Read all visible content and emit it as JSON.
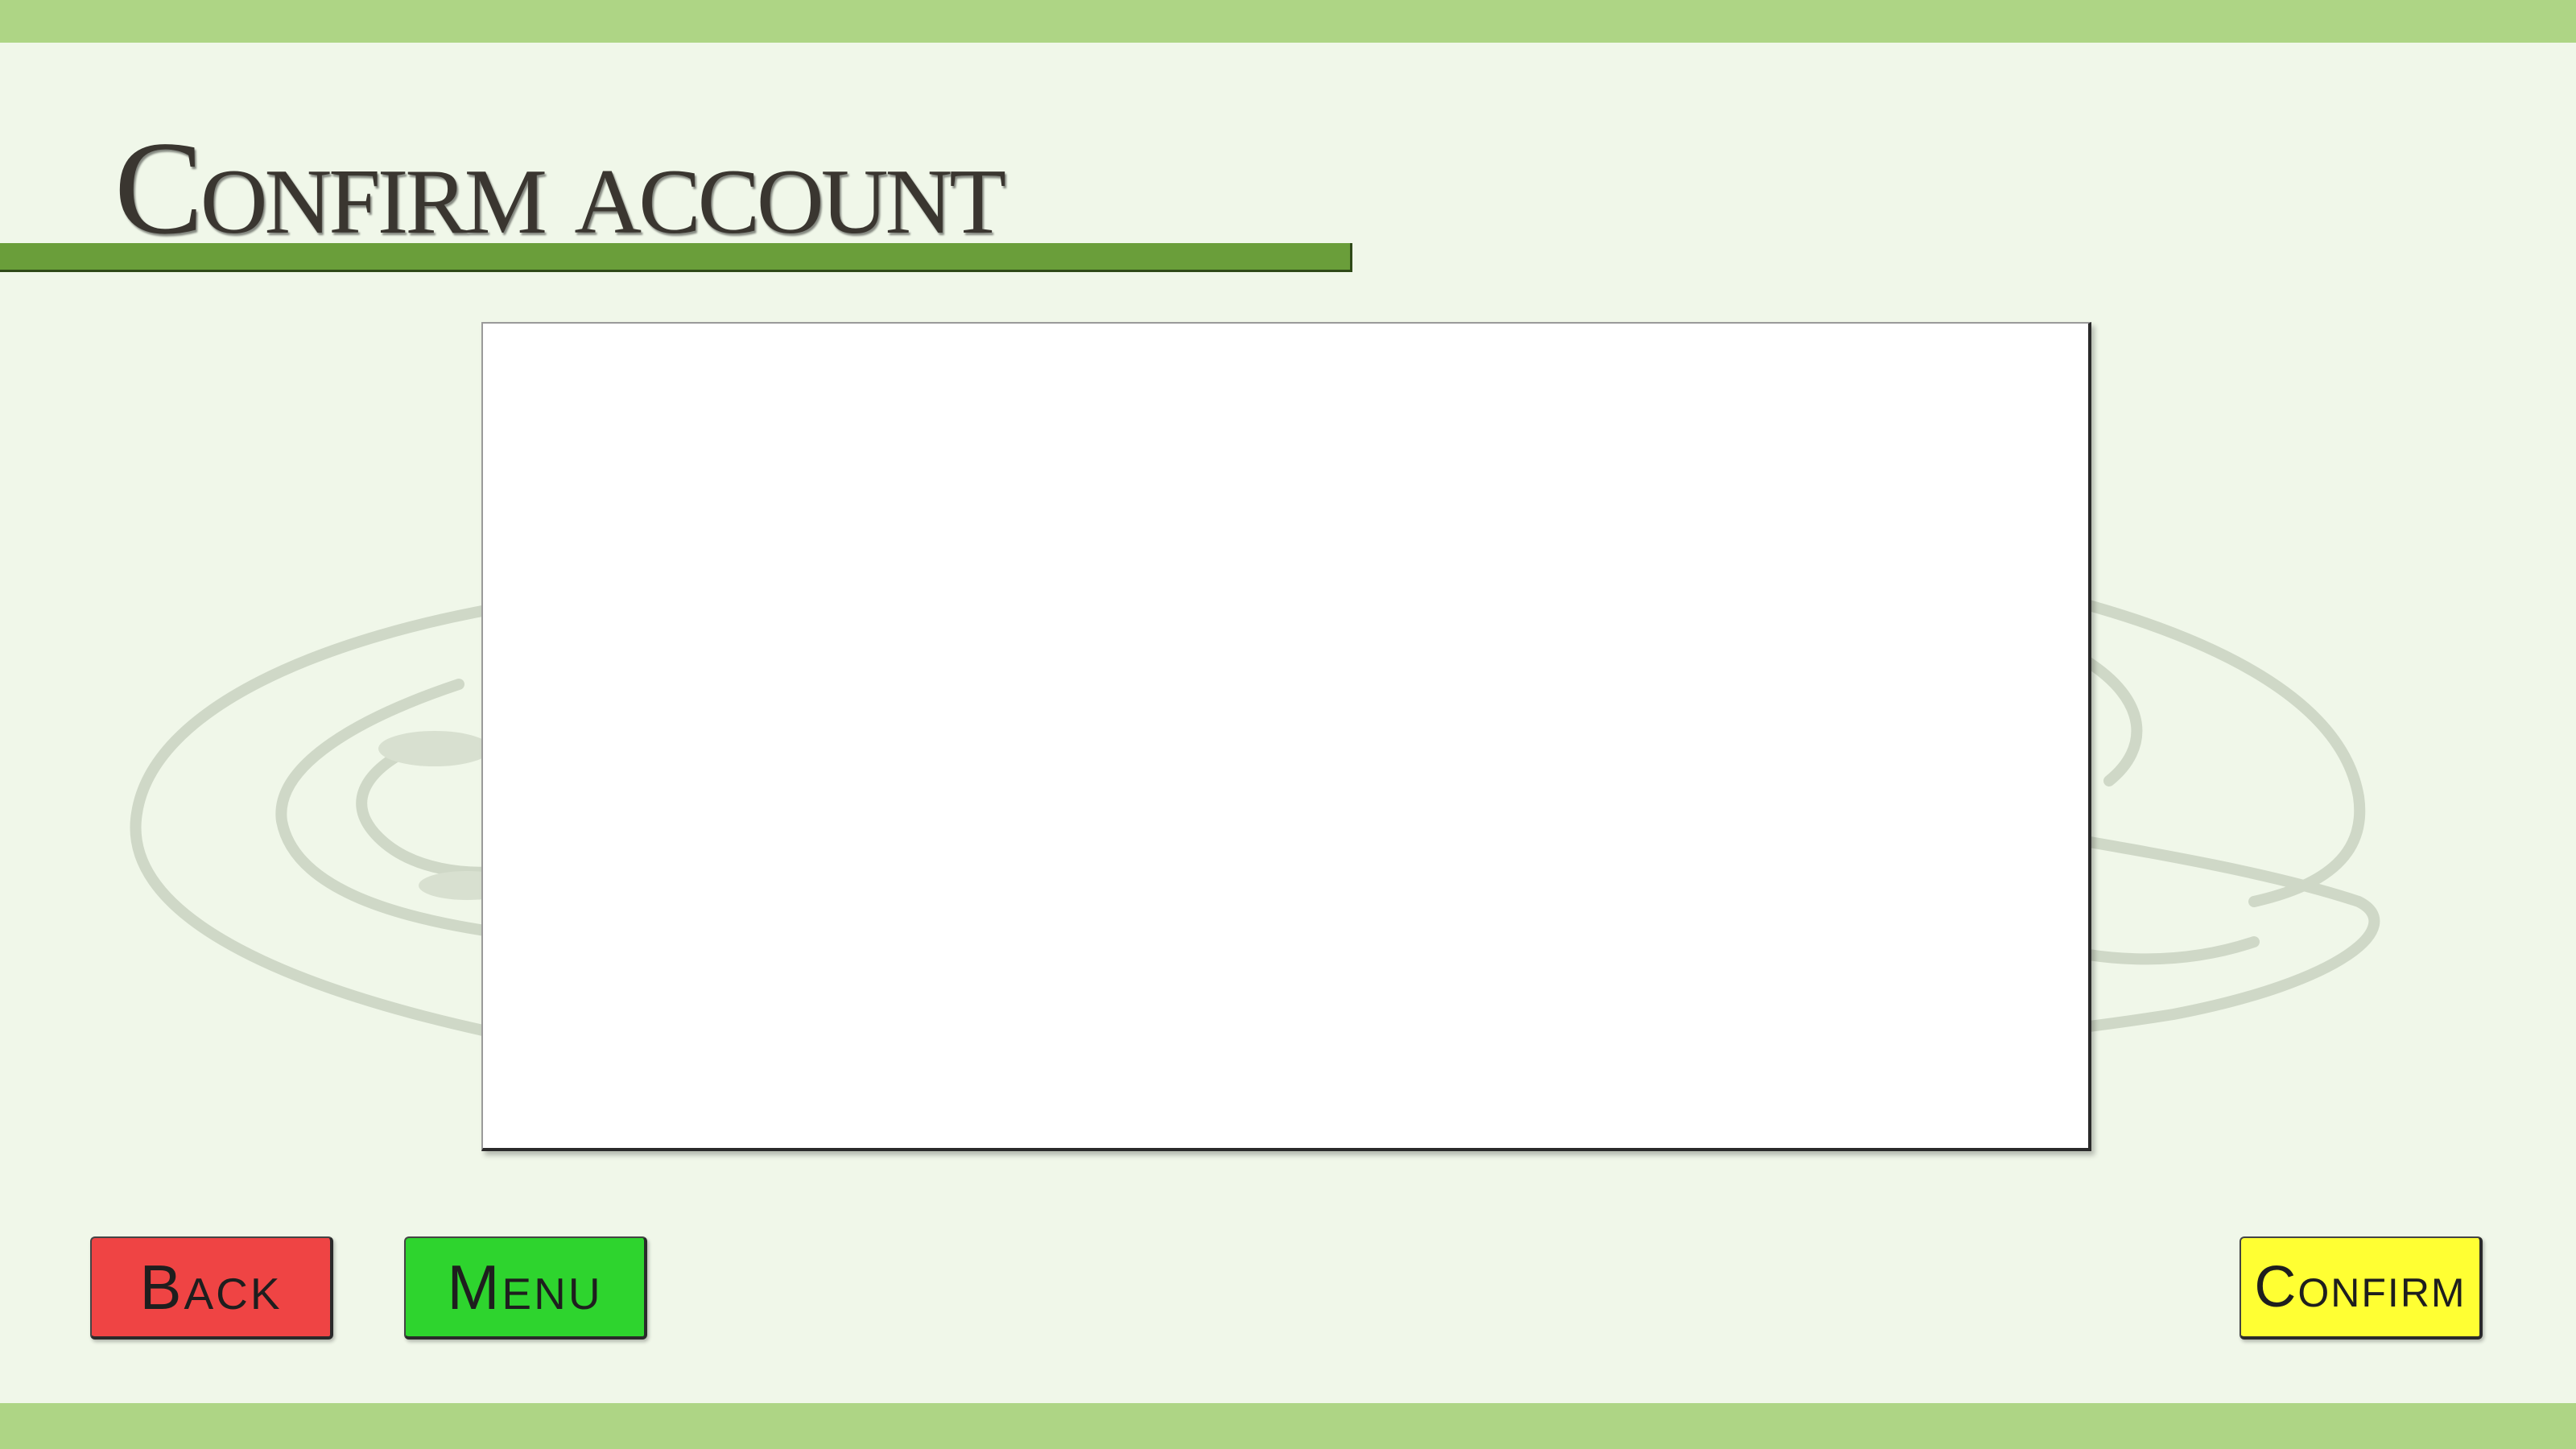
{
  "header": {
    "title": "Confirm account"
  },
  "buttons": {
    "back_label": "Back",
    "menu_label": "Menu",
    "confirm_label": "Confirm"
  },
  "colors": {
    "frame_bar": "#aed585",
    "background": "#f0f7e9",
    "title_underline": "#6a9e3a",
    "back_button": "#ef4444",
    "menu_button": "#2ed42e",
    "confirm_button": "#ffff33"
  },
  "icons": {
    "watermark": "faded-sketch-watermark"
  }
}
